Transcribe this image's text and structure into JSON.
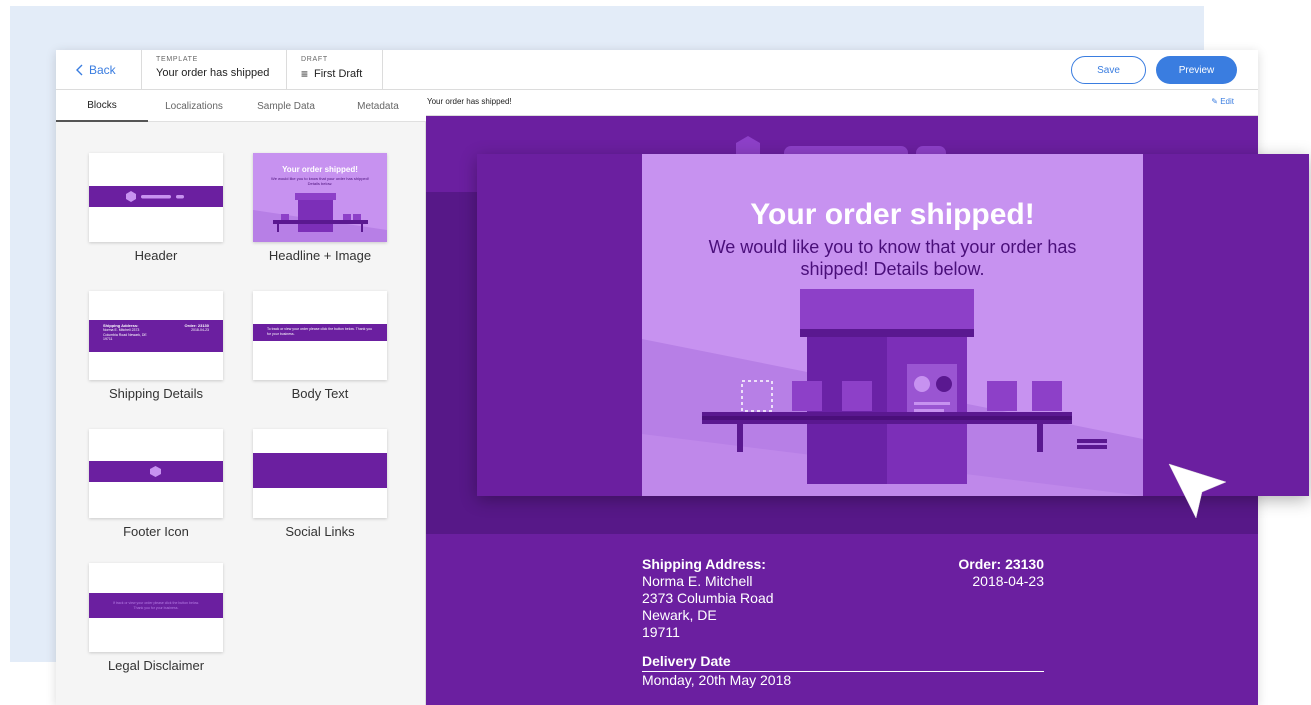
{
  "topbar": {
    "back_label": "Back",
    "template_label": "TEMPLATE",
    "template_value": "Your order has shipped",
    "draft_label": "DRAFT",
    "draft_value": "First Draft",
    "save_label": "Save",
    "preview_label": "Preview"
  },
  "sidebar": {
    "tabs": [
      "Blocks",
      "Localizations",
      "Sample Data",
      "Metadata"
    ],
    "active_tab": "Blocks",
    "blocks": [
      {
        "label": "Header"
      },
      {
        "label": "Headline + Image",
        "thumb_title": "Your order shipped!",
        "thumb_sub": "We would like you to know that your order has shipped! Details below."
      },
      {
        "label": "Shipping Details",
        "thumb_left_title": "Shipping Address:",
        "thumb_left_lines": "Norma E. Mitchell 2373 Columbia Road Newark, DE 19711",
        "thumb_right_title": "Order: 23130",
        "thumb_right_date": "2018-04-23"
      },
      {
        "label": "Body Text",
        "thumb_text": "To track or view your order please click the button below. Thank you for your business."
      },
      {
        "label": "Footer Icon"
      },
      {
        "label": "Social Links"
      },
      {
        "label": "Legal Disclaimer",
        "thumb_text": "If track or view your order please click the button below. Thank you for your business."
      }
    ]
  },
  "canvas": {
    "title": "Your order has shipped!",
    "edit_label": "Edit",
    "hero_title": "Your order shipped!",
    "hero_sub": "We would like you to know that your order has shipped! Details below.",
    "shipping_label": "Shipping Address:",
    "shipping_name": "Norma E. Mitchell",
    "shipping_street": "2373 Columbia Road",
    "shipping_city": "Newark, DE",
    "shipping_zip": "19711",
    "order_label": "Order: 23130",
    "order_date": "2018-04-23",
    "delivery_label": "Delivery Date",
    "delivery_value": "Monday, 20th May 2018"
  },
  "colors": {
    "accent": "#3a7de0",
    "brand_purple": "#6b1fa0",
    "dark_purple": "#571888",
    "light_purple": "#c792f0",
    "background_tint": "#e3ecf8"
  }
}
